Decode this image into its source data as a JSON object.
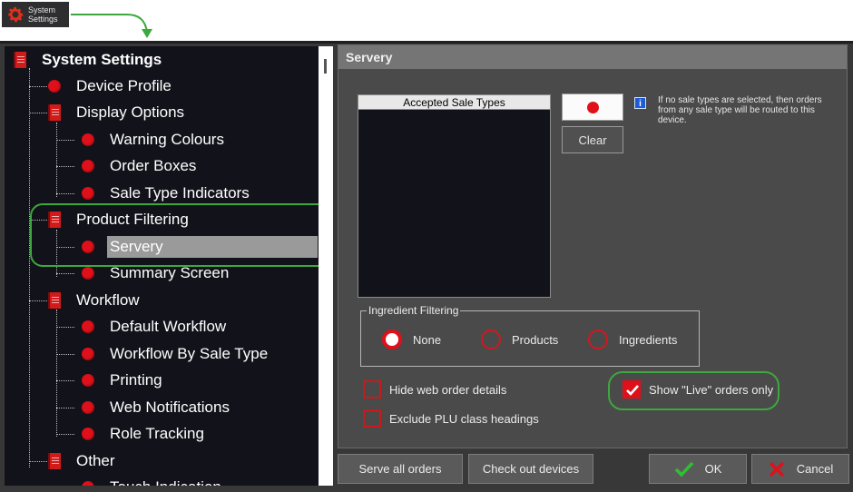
{
  "launcher": {
    "label": "System\nSettings"
  },
  "tree": {
    "root": "System Settings",
    "items": [
      {
        "label": "Device Profile"
      },
      {
        "label": "Display Options"
      },
      {
        "label": "Warning Colours"
      },
      {
        "label": "Order Boxes"
      },
      {
        "label": "Sale Type Indicators"
      },
      {
        "label": "Product Filtering"
      },
      {
        "label": "Servery"
      },
      {
        "label": "Summary Screen"
      },
      {
        "label": "Workflow"
      },
      {
        "label": "Default Workflow"
      },
      {
        "label": "Workflow By Sale Type"
      },
      {
        "label": "Printing"
      },
      {
        "label": "Web Notifications"
      },
      {
        "label": "Role Tracking"
      },
      {
        "label": "Other"
      },
      {
        "label": "Touch Indication"
      }
    ]
  },
  "panel": {
    "title": "Servery",
    "sale_types_header": "Accepted Sale Types",
    "clear_label": "Clear",
    "info_icon": "i",
    "info_text": "If no sale types are selected, then orders from any sale type will be routed to this device.",
    "ingredient_filtering": {
      "legend": "Ingredient Filtering",
      "options": [
        "None",
        "Products",
        "Ingredients"
      ],
      "selected": "None"
    },
    "checkboxes": {
      "hide_web": {
        "label": "Hide web order details",
        "checked": false
      },
      "exclude_plu": {
        "label": "Exclude PLU class headings",
        "checked": false
      },
      "show_live": {
        "label": "Show \"Live\" orders only",
        "checked": true
      }
    }
  },
  "buttons": {
    "serve_all": "Serve all orders",
    "check_out": "Check out devices",
    "ok": "OK",
    "cancel": "Cancel"
  },
  "colors": {
    "accent_red": "#e0101a",
    "highlight_green": "#3da83d",
    "selected_row": "#9a9a9a"
  }
}
